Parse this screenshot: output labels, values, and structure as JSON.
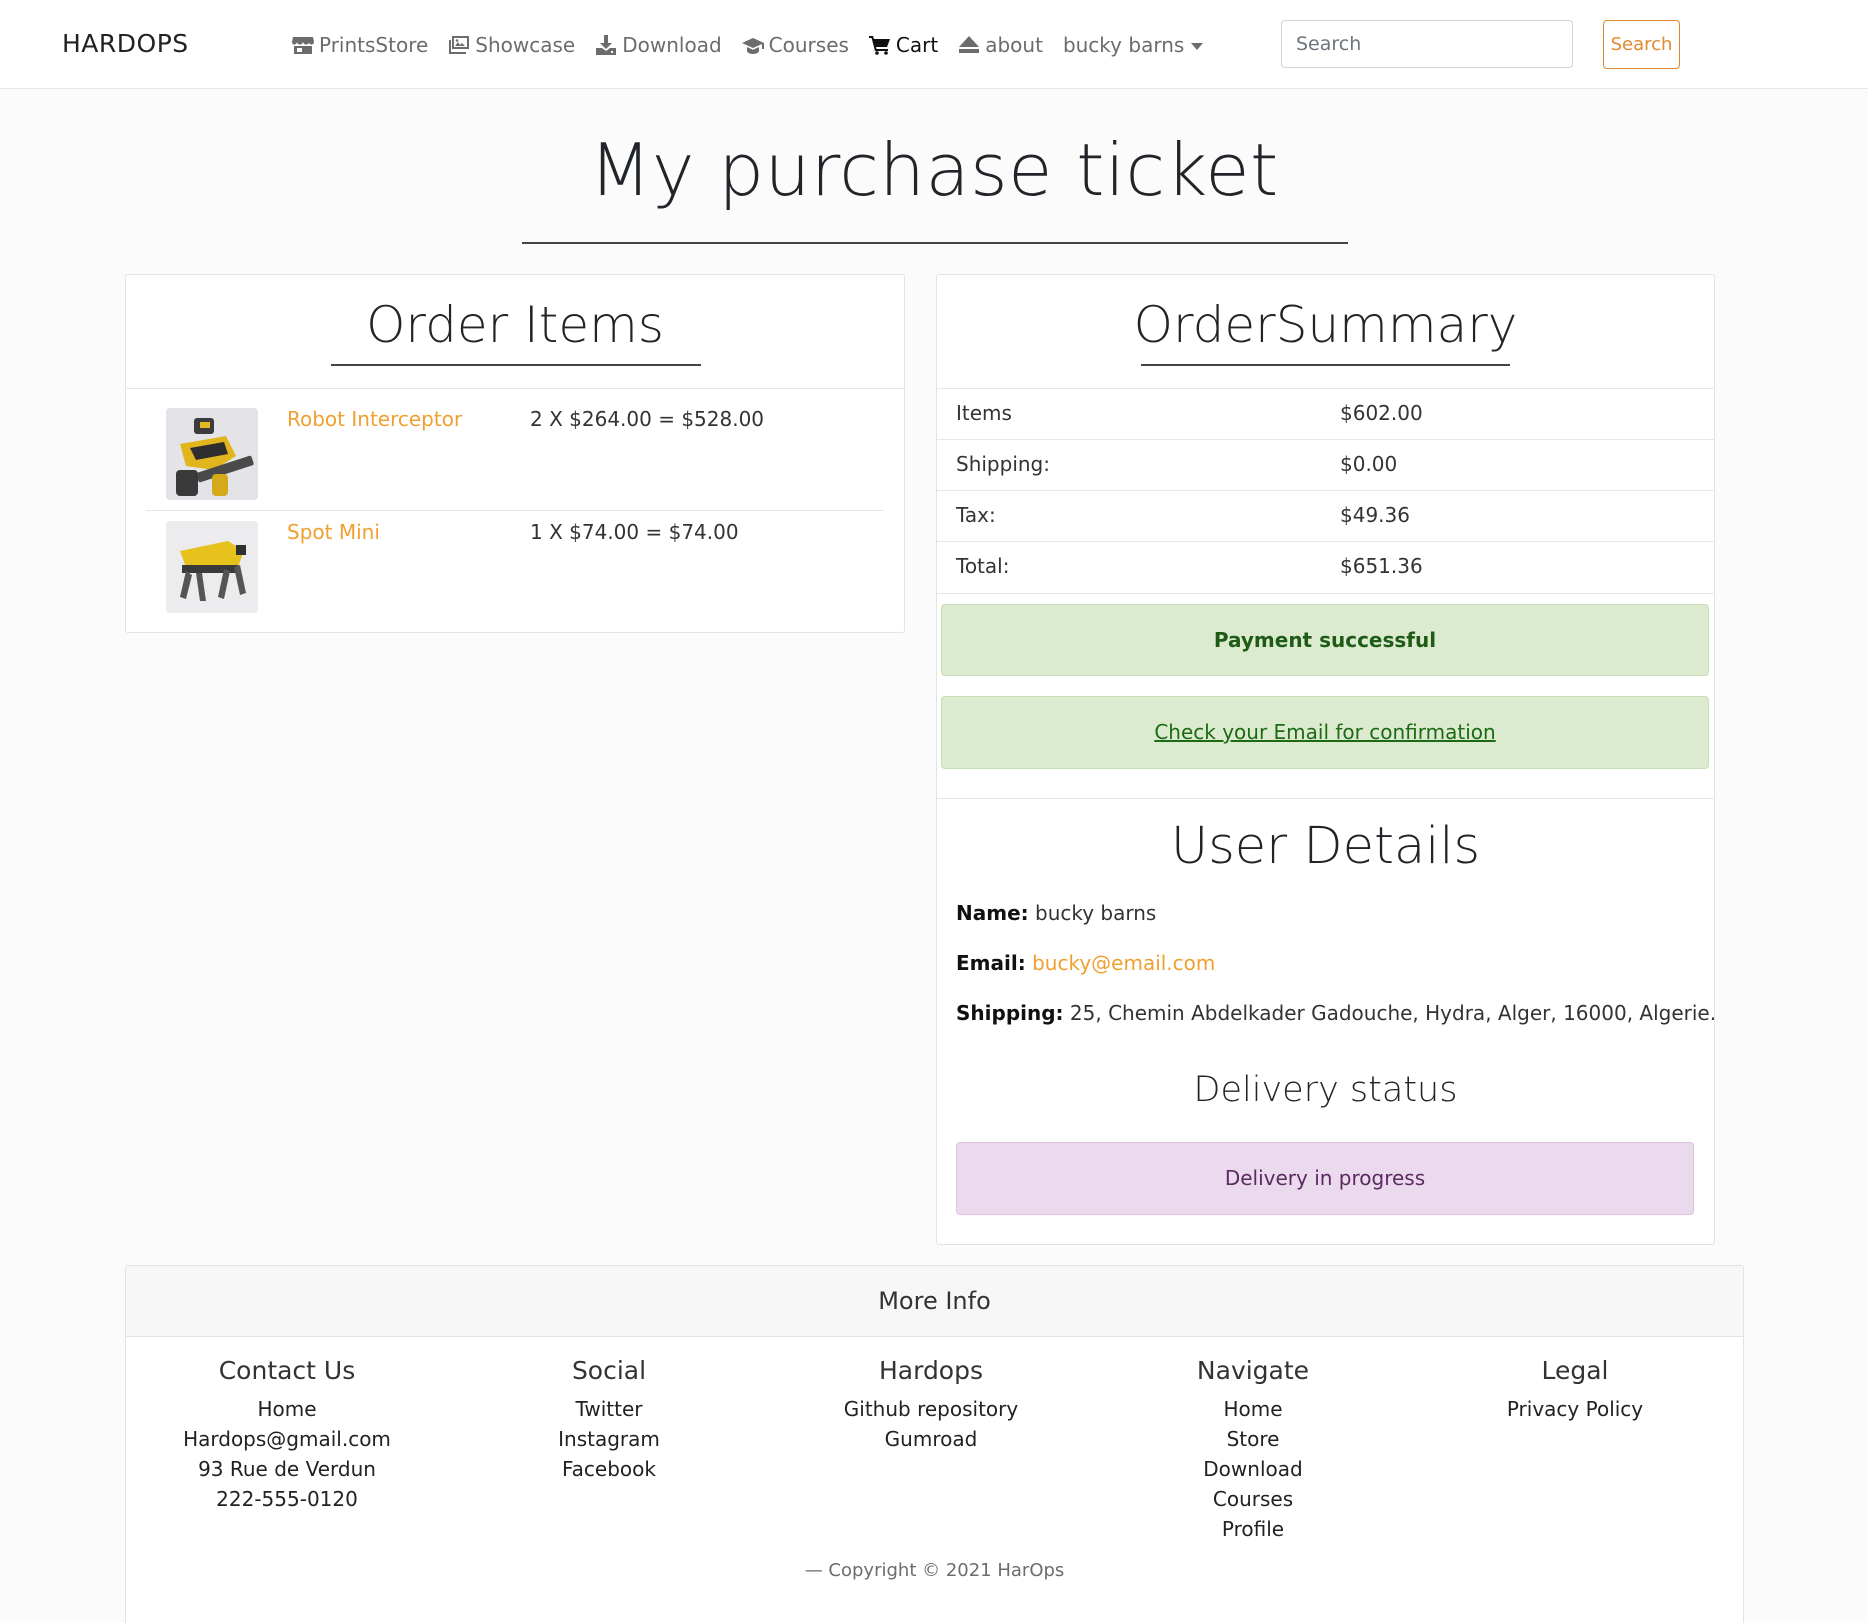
{
  "navbar": {
    "brand": "HARDOPS",
    "links": [
      {
        "label": "PrintsStore",
        "icon": "store-icon"
      },
      {
        "label": "Showcase",
        "icon": "images-icon"
      },
      {
        "label": "Download",
        "icon": "download-icon"
      },
      {
        "label": "Courses",
        "icon": "graduation-cap-icon"
      },
      {
        "label": "Cart",
        "icon": "cart-icon",
        "active": true
      },
      {
        "label": "about",
        "icon": "eject-icon"
      }
    ],
    "user_menu": "bucky barns",
    "search_placeholder": "Search",
    "search_button": "Search"
  },
  "page": {
    "title": "My purchase ticket"
  },
  "order_items": {
    "heading": "Order Items",
    "items": [
      {
        "name": "Robot Interceptor",
        "calc": "2 X $264.00 = $528.00"
      },
      {
        "name": "Spot Mini",
        "calc": "1 X $74.00 = $74.00"
      }
    ]
  },
  "order_summary": {
    "heading": "OrderSummary",
    "rows": [
      {
        "label": "Items",
        "value": "$602.00"
      },
      {
        "label": "Shipping:",
        "value": "$0.00"
      },
      {
        "label": "Tax:",
        "value": "$49.36"
      },
      {
        "label": "Total:",
        "value": "$651.36"
      }
    ],
    "payment_status": "Payment successful",
    "email_notice": "Check your Email for confirmation"
  },
  "user_details": {
    "heading": "User Details",
    "name_label": "Name:",
    "name": "bucky barns",
    "email_label": "Email:",
    "email": "bucky@email.com",
    "shipping_label": "Shipping:",
    "shipping": "25, Chemin Abdelkader Gadouche, Hydra, Alger, 16000, Algerie.",
    "delivery_heading": "Delivery status",
    "delivery_status": "Delivery in progress"
  },
  "footer": {
    "heading": "More Info",
    "columns": [
      {
        "title": "Contact Us",
        "items": [
          "Home",
          "Hardops@gmail.com",
          "93 Rue de Verdun",
          "222-555-0120"
        ]
      },
      {
        "title": "Social",
        "items": [
          "Twitter",
          "Instagram",
          "Facebook"
        ]
      },
      {
        "title": "Hardops",
        "items": [
          "Github repository",
          "Gumroad"
        ]
      },
      {
        "title": "Navigate",
        "items": [
          "Home",
          "Store",
          "Download",
          "Courses",
          "Profile"
        ]
      },
      {
        "title": "Legal",
        "items": [
          "Privacy Policy"
        ]
      }
    ],
    "copyright": "— Copyright © 2021 HarOps"
  },
  "colors": {
    "accent": "#f0a030",
    "search_button": "#e0892e",
    "success_bg": "#dcebd0",
    "success_text": "#1e5b16",
    "delivery_bg": "#ebdaed",
    "delivery_text": "#5b2a60"
  }
}
